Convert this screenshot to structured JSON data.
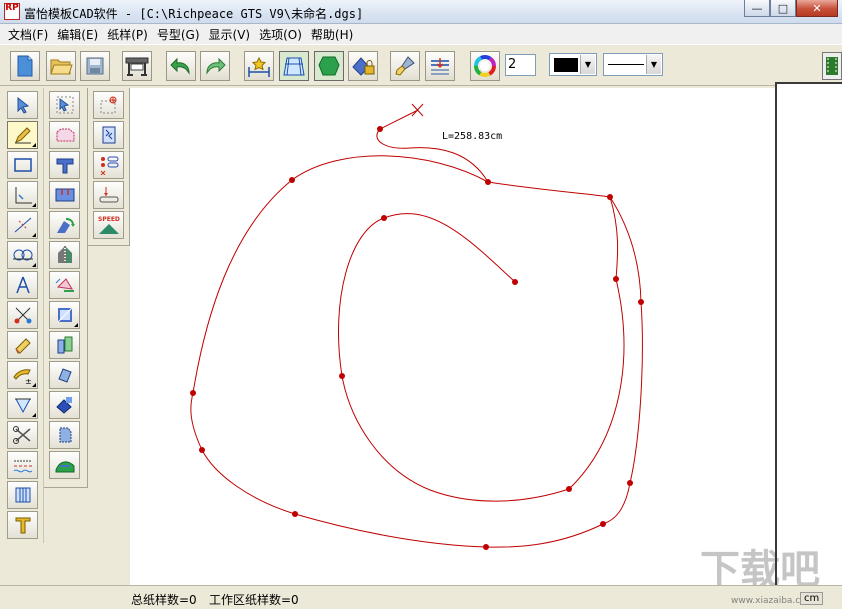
{
  "window": {
    "title": "富怡模板CAD软件 - [C:\\Richpeace GTS V9\\未命名.dgs]",
    "icon_text": "RP"
  },
  "menu": [
    {
      "label": "文档(F)"
    },
    {
      "label": "编辑(E)"
    },
    {
      "label": "纸样(P)"
    },
    {
      "label": "号型(G)"
    },
    {
      "label": "显示(V)"
    },
    {
      "label": "选项(O)"
    },
    {
      "label": "帮助(H)"
    }
  ],
  "toolbar": {
    "number_value": "2",
    "line_color": "#000000",
    "icons": [
      "new-document-icon",
      "open-folder-icon",
      "save-disk-icon",
      "plotter-icon",
      "undo-icon",
      "redo-icon",
      "grading-icon",
      "grid-pattern-icon",
      "pattern-piece-icon",
      "lock-icon",
      "paint-brush-icon",
      "layers-icon",
      "color-wheel-icon"
    ]
  },
  "canvas": {
    "measurement_label": "L=258.83cm",
    "curve_color": "#c00000"
  },
  "status": {
    "total_pieces": "总纸样数=0",
    "workspace_pieces": "工作区纸样数=0",
    "unit": "cm"
  },
  "watermark": {
    "text": "www.xiazaiba.com"
  }
}
